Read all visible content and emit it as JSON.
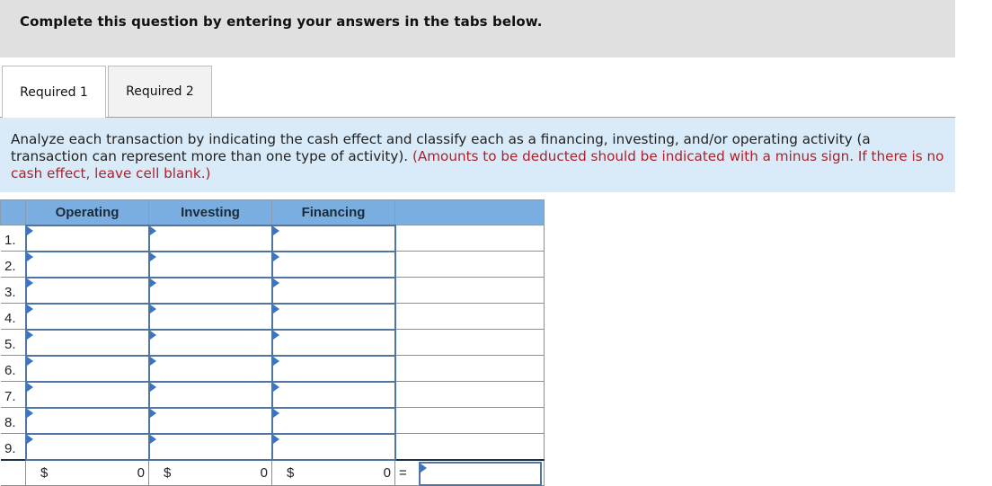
{
  "banner": {
    "text": "Complete this question by entering your answers in the tabs below."
  },
  "tabs": [
    {
      "label": "Required 1",
      "active": true
    },
    {
      "label": "Required 2",
      "active": false
    }
  ],
  "instructions": {
    "main": "Analyze each transaction by indicating the cash effect and classify each as a financing, investing, and/or operating activity (a transaction can represent more than one type of activity).",
    "note": "(Amounts to be deducted should be indicated with a minus sign. If there is no cash effect, leave cell blank.)"
  },
  "table": {
    "headers": [
      "",
      "Operating",
      "Investing",
      "Financing",
      ""
    ],
    "rows": [
      {
        "label": "1.",
        "operating": "",
        "investing": "",
        "financing": ""
      },
      {
        "label": "2.",
        "operating": "",
        "investing": "",
        "financing": ""
      },
      {
        "label": "3.",
        "operating": "",
        "investing": "",
        "financing": ""
      },
      {
        "label": "4.",
        "operating": "",
        "investing": "",
        "financing": ""
      },
      {
        "label": "5.",
        "operating": "",
        "investing": "",
        "financing": ""
      },
      {
        "label": "6.",
        "operating": "",
        "investing": "",
        "financing": ""
      },
      {
        "label": "7.",
        "operating": "",
        "investing": "",
        "financing": ""
      },
      {
        "label": "8.",
        "operating": "",
        "investing": "",
        "financing": ""
      },
      {
        "label": "9.",
        "operating": "",
        "investing": "",
        "financing": ""
      }
    ],
    "totals": {
      "currency": "$",
      "operating": "0",
      "investing": "0",
      "financing": "0",
      "equals": "=",
      "net_change": ""
    }
  },
  "colors": {
    "banner_bg": "#e0e0e0",
    "instruction_bg": "#d9ebf9",
    "note_red": "#b0202a",
    "header_blue": "#7aaee0",
    "input_border": "#4f76a3",
    "flag_blue": "#3a74c4"
  }
}
